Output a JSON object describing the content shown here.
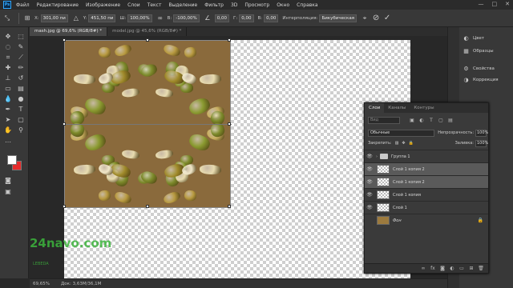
{
  "menu": [
    "Файл",
    "Редактирование",
    "Изображение",
    "Слои",
    "Текст",
    "Выделение",
    "Фильтр",
    "3D",
    "Просмотр",
    "Окно",
    "Справка"
  ],
  "window_controls": [
    "—",
    "□",
    "✕"
  ],
  "options": {
    "x_label": "X:",
    "x_value": "301,00 пи",
    "y_label": "Y:",
    "y_value": "451,50 пи",
    "w_label": "Ш:",
    "w_value": "100,00%",
    "h_label": "В:",
    "h_value": "-100,00%",
    "angle_value": "0,00",
    "hskew_label": "Г:",
    "hskew_value": "0,00",
    "vskew_label": "В:",
    "vskew_value": "0,00",
    "interp_label": "Интерполяция:",
    "interp_value": "Бикубическая",
    "cancel_symbol": "⊘",
    "commit_symbol": "✓"
  },
  "doc_tabs": [
    "mash.jpg @ 69,6% (RGB/8#) *",
    "model.jpg @ 45,6% (RGB/8#) *"
  ],
  "status": {
    "zoom": "69,65%",
    "doc": "Док: 3,63M/36,1M"
  },
  "dock": [
    {
      "icon": "palette-icon",
      "label": "Цвет"
    },
    {
      "icon": "swatches-icon",
      "label": "Образцы"
    },
    {
      "icon": "properties-icon",
      "label": "Свойства"
    },
    {
      "icon": "adjustments-icon",
      "label": "Коррекция"
    }
  ],
  "layers": {
    "tabs": [
      "Слои",
      "Каналы",
      "Контуры"
    ],
    "search_placeholder": "Вид",
    "blend_mode": "Обычные",
    "opacity_label": "Непрозрачность:",
    "opacity_value": "100%",
    "lock_label": "Закрепить:",
    "fill_label": "Заливка:",
    "fill_value": "100%",
    "items": [
      {
        "name": "Группа 1",
        "type": "group",
        "selected": false
      },
      {
        "name": "Слой 1 копия 2",
        "type": "layer",
        "selected": true
      },
      {
        "name": "Слой 1 копия 2",
        "type": "layer",
        "selected": true
      },
      {
        "name": "Слой 1 копия",
        "type": "layer",
        "selected": false
      },
      {
        "name": "Слой 1",
        "type": "layer",
        "selected": false
      },
      {
        "name": "Фон",
        "type": "background",
        "selected": false
      }
    ]
  },
  "watermark": {
    "text": "24navo.com",
    "sub": "LEBEDA"
  }
}
